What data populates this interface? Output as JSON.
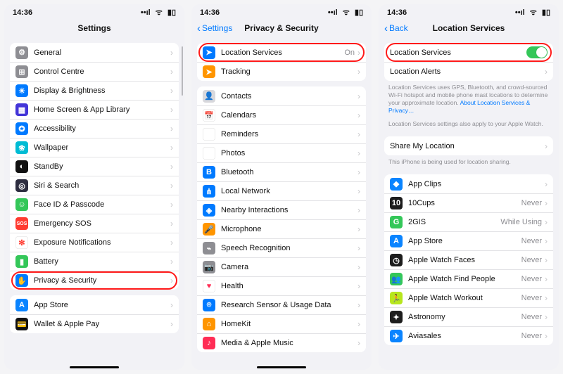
{
  "status": {
    "time": "14:36",
    "signal": "􀙇",
    "wifi": "􀙈",
    "battery": "􀛨"
  },
  "screen1": {
    "title": "Settings",
    "group1": [
      {
        "name": "general",
        "label": "General",
        "iconBg": "#8e8e93",
        "glyph": "⚙"
      },
      {
        "name": "control-centre",
        "label": "Control Centre",
        "iconBg": "#8e8e93",
        "glyph": "⊞"
      },
      {
        "name": "display-brightness",
        "label": "Display & Brightness",
        "iconBg": "#007aff",
        "glyph": "☀"
      },
      {
        "name": "home-screen-app-library",
        "label": "Home Screen & App Library",
        "iconBg": "#4335d8",
        "glyph": "▦"
      },
      {
        "name": "accessibility",
        "label": "Accessibility",
        "iconBg": "#007aff",
        "glyph": "✪"
      },
      {
        "name": "wallpaper",
        "label": "Wallpaper",
        "iconBg": "#00bcd4",
        "glyph": "❀"
      },
      {
        "name": "standby",
        "label": "StandBy",
        "iconBg": "#111",
        "glyph": "◐"
      },
      {
        "name": "siri-search",
        "label": "Siri & Search",
        "iconBg": "#2d2d40",
        "glyph": "◎"
      },
      {
        "name": "face-id-passcode",
        "label": "Face ID & Passcode",
        "iconBg": "#34c759",
        "glyph": "☺"
      },
      {
        "name": "emergency-sos",
        "label": "Emergency SOS",
        "iconBg": "#ff3b30",
        "glyph": "SOS"
      },
      {
        "name": "exposure-notifications",
        "label": "Exposure Notifications",
        "iconBg": "#fff",
        "glyph": "✻",
        "glyphColor": "#ff3b30"
      },
      {
        "name": "battery",
        "label": "Battery",
        "iconBg": "#34c759",
        "glyph": "▮"
      },
      {
        "name": "privacy-security",
        "label": "Privacy & Security",
        "iconBg": "#007aff",
        "glyph": "✋",
        "highlighted": true
      }
    ],
    "group2": [
      {
        "name": "app-store",
        "label": "App Store",
        "iconBg": "#0a84ff",
        "glyph": "A"
      },
      {
        "name": "wallet-apple-pay",
        "label": "Wallet & Apple Pay",
        "iconBg": "#111",
        "glyph": "💳"
      }
    ]
  },
  "screen2": {
    "backLabel": "Settings",
    "title": "Privacy & Security",
    "group1": [
      {
        "name": "location-services",
        "label": "Location Services",
        "value": "On",
        "iconBg": "#007aff",
        "glyph": "➤",
        "highlighted": true
      },
      {
        "name": "tracking",
        "label": "Tracking",
        "iconBg": "#ff9500",
        "glyph": "➤"
      }
    ],
    "group2": [
      {
        "name": "contacts",
        "label": "Contacts",
        "iconBg": "#d8d8dc",
        "glyph": "👤"
      },
      {
        "name": "calendars",
        "label": "Calendars",
        "iconBg": "#fff",
        "glyph": "📅"
      },
      {
        "name": "reminders",
        "label": "Reminders",
        "iconBg": "#fff",
        "glyph": "⋮"
      },
      {
        "name": "photos",
        "label": "Photos",
        "iconBg": "#fff",
        "glyph": "✿"
      },
      {
        "name": "bluetooth",
        "label": "Bluetooth",
        "iconBg": "#007aff",
        "glyph": "B"
      },
      {
        "name": "local-network",
        "label": "Local Network",
        "iconBg": "#007aff",
        "glyph": "⋔"
      },
      {
        "name": "nearby-interactions",
        "label": "Nearby Interactions",
        "iconBg": "#007aff",
        "glyph": "◈"
      },
      {
        "name": "microphone",
        "label": "Microphone",
        "iconBg": "#ff9500",
        "glyph": "🎤"
      },
      {
        "name": "speech-recognition",
        "label": "Speech Recognition",
        "iconBg": "#8e8e93",
        "glyph": "⌁"
      },
      {
        "name": "camera",
        "label": "Camera",
        "iconBg": "#8e8e93",
        "glyph": "📷"
      },
      {
        "name": "health",
        "label": "Health",
        "iconBg": "#fff",
        "glyph": "♥",
        "glyphColor": "#ff2d55"
      },
      {
        "name": "research-sensor-usage-data",
        "label": "Research Sensor & Usage Data",
        "iconBg": "#007aff",
        "glyph": "⌾"
      },
      {
        "name": "homekit",
        "label": "HomeKit",
        "iconBg": "#ff9500",
        "glyph": "⌂"
      },
      {
        "name": "media-apple-music",
        "label": "Media & Apple Music",
        "iconBg": "#ff2d55",
        "glyph": "♪"
      }
    ]
  },
  "screen3": {
    "backLabel": "Back",
    "title": "Location Services",
    "group1": [
      {
        "name": "location-services-toggle",
        "label": "Location Services",
        "toggle": true,
        "highlighted": true
      },
      {
        "name": "location-alerts",
        "label": "Location Alerts"
      }
    ],
    "footer1a": "Location Services uses GPS, Bluetooth, and crowd-sourced Wi-Fi hotspot and mobile phone mast locations to determine your approximate location.",
    "footer1link": "About Location Services & Privacy…",
    "footer1b": "Location Services settings also apply to your Apple Watch.",
    "group2": [
      {
        "name": "share-my-location",
        "label": "Share My Location"
      }
    ],
    "footer2": "This iPhone is being used for location sharing.",
    "group3": [
      {
        "name": "app-clips",
        "label": "App Clips",
        "iconBg": "#0a84ff",
        "glyph": "◆",
        "value": ""
      },
      {
        "name": "10cups",
        "label": "10Cups",
        "iconBg": "#1d1d1d",
        "glyph": "10",
        "value": "Never"
      },
      {
        "name": "2gis",
        "label": "2GIS",
        "iconBg": "#34c759",
        "glyph": "G",
        "value": "While Using"
      },
      {
        "name": "app-store-app",
        "label": "App Store",
        "iconBg": "#0a84ff",
        "glyph": "A",
        "value": "Never"
      },
      {
        "name": "apple-watch-faces",
        "label": "Apple Watch Faces",
        "iconBg": "#1d1d1d",
        "glyph": "◷",
        "value": "Never"
      },
      {
        "name": "apple-watch-find-people",
        "label": "Apple Watch Find People",
        "iconBg": "#34c759",
        "glyph": "👥",
        "value": "Never"
      },
      {
        "name": "apple-watch-workout",
        "label": "Apple Watch Workout",
        "iconBg": "#b7e61e",
        "glyph": "🏃",
        "value": "Never"
      },
      {
        "name": "astronomy",
        "label": "Astronomy",
        "iconBg": "#1d1d1d",
        "glyph": "✦",
        "value": "Never"
      },
      {
        "name": "aviasales",
        "label": "Aviasales",
        "iconBg": "#0a84ff",
        "glyph": "✈",
        "value": "Never"
      }
    ]
  }
}
